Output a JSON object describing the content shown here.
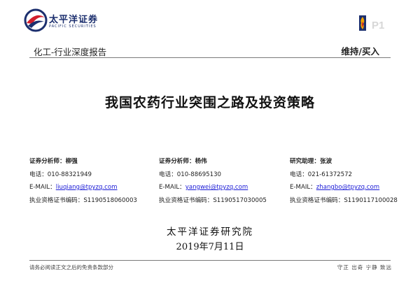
{
  "header": {
    "logo_cn": "太平洋证券",
    "logo_en": "PACIFIC SECURITIES",
    "page_number": "P1",
    "brand_color": "#1c2f6e",
    "accent_color": "#d21e2b",
    "corner_icon": "flame-badge-icon"
  },
  "report": {
    "type": "化工-行业深度报告",
    "rating": "维持/买入",
    "title": "我国农药行业突围之路及投资策略"
  },
  "analysts": [
    {
      "role_name": "证券分析师：柳强",
      "phone": "电话：010-88321949",
      "email_label": "E-MAIL：",
      "email": "liuqiang@tpyzq.com",
      "cert": "执业资格证书编码：S1190518060003"
    },
    {
      "role_name": "证券分析师：杨伟",
      "phone": "电话：010-88695130",
      "email_label": "E-MAIL：",
      "email": "yangwei@tpyzq.com",
      "cert": "执业资格证书编码：S1190517030005"
    },
    {
      "role_name": "研究助理：张波",
      "phone": "电话：021-61372572",
      "email_label": "E-MAIL：",
      "email": "zhangbo@tpyzq.com",
      "cert": "执业资格证书编码：S1190117100028"
    }
  ],
  "institute": "太平洋证券研究院",
  "date": "2019年7月11日",
  "footer": {
    "left": "请务必阅读正文之后的免责条款部分",
    "right": "守正 出奇 宁静 致远"
  }
}
